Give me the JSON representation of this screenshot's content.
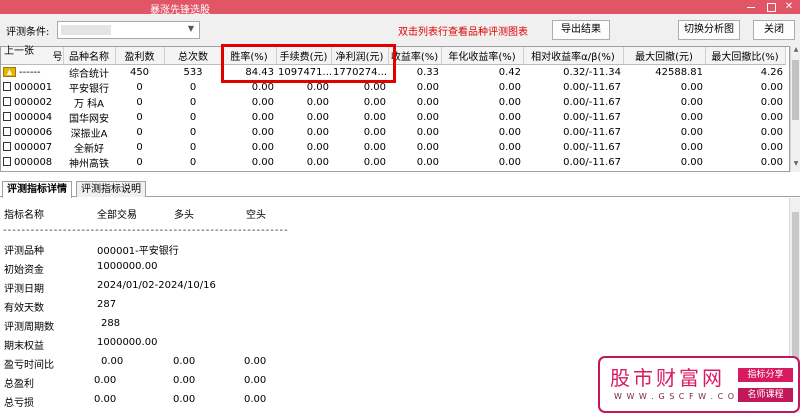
{
  "window": {
    "title": "暴涨先锋选股"
  },
  "toolbar": {
    "condition_label": "评测条件:",
    "hint": "双击列表行查看品种评测图表",
    "export_label": "导出结果",
    "chart_label": "切换分析图",
    "close_label": "关闭",
    "prev_label": "上一张"
  },
  "grid": {
    "columns": [
      "号",
      "品种名称",
      "盈利数",
      "总次数",
      "胜率(%)",
      "手续费(元)",
      "净利润(元)",
      "收益率(%)",
      "年化收益率(%)",
      "相对收益率α/β(%)",
      "最大回撤(元)",
      "最大回撤比(%)"
    ],
    "total_row": {
      "code": "------",
      "name": "综合统计",
      "profit": "450",
      "count": "533",
      "win": "84.43",
      "fee": "1097471...",
      "net": "1770274...",
      "ret": "0.33",
      "annual": "0.42",
      "rel": "0.32/-11.34",
      "mdd": "42588.81",
      "mddp": "4.26"
    },
    "rows": [
      {
        "code": "000001",
        "name": "平安银行",
        "profit": "0",
        "count": "0",
        "win": "0.00",
        "fee": "0.00",
        "net": "0.00",
        "ret": "0.00",
        "annual": "0.00",
        "rel": "0.00/-11.67",
        "mdd": "0.00",
        "mddp": "0.00"
      },
      {
        "code": "000002",
        "name": "万 科A",
        "profit": "0",
        "count": "0",
        "win": "0.00",
        "fee": "0.00",
        "net": "0.00",
        "ret": "0.00",
        "annual": "0.00",
        "rel": "0.00/-11.67",
        "mdd": "0.00",
        "mddp": "0.00"
      },
      {
        "code": "000004",
        "name": "国华网安",
        "profit": "0",
        "count": "0",
        "win": "0.00",
        "fee": "0.00",
        "net": "0.00",
        "ret": "0.00",
        "annual": "0.00",
        "rel": "0.00/-11.67",
        "mdd": "0.00",
        "mddp": "0.00"
      },
      {
        "code": "000006",
        "name": "深振业A",
        "profit": "0",
        "count": "0",
        "win": "0.00",
        "fee": "0.00",
        "net": "0.00",
        "ret": "0.00",
        "annual": "0.00",
        "rel": "0.00/-11.67",
        "mdd": "0.00",
        "mddp": "0.00"
      },
      {
        "code": "000007",
        "name": "全新好",
        "profit": "0",
        "count": "0",
        "win": "0.00",
        "fee": "0.00",
        "net": "0.00",
        "ret": "0.00",
        "annual": "0.00",
        "rel": "0.00/-11.67",
        "mdd": "0.00",
        "mddp": "0.00"
      },
      {
        "code": "000008",
        "name": "神州高铁",
        "profit": "0",
        "count": "0",
        "win": "0.00",
        "fee": "0.00",
        "net": "0.00",
        "ret": "0.00",
        "annual": "0.00",
        "rel": "0.00/-11.67",
        "mdd": "0.00",
        "mddp": "0.00"
      }
    ]
  },
  "tabs": [
    "评测指标详情",
    "评测指标说明"
  ],
  "detail": {
    "header": {
      "c1": "指标名称",
      "c2": "全部交易",
      "c3": "多头",
      "c4": "空头"
    },
    "dashes": "--------------------------------------------------------------",
    "items": [
      {
        "label": "评测品种",
        "v1": "000001-平安银行"
      },
      {
        "label": "初始资金",
        "v1": "1000000.00"
      },
      {
        "label": "评测日期",
        "v1": "2024/01/02-2024/10/16"
      },
      {
        "label": "有效天数",
        "v1": "287"
      },
      {
        "label": "评测周期数",
        "v1": "288"
      },
      {
        "label": "期末权益",
        "v1": "1000000.00"
      },
      {
        "label": "盈亏时间比",
        "v1": "0.00",
        "v2": "0.00",
        "v3": "0.00"
      },
      {
        "label": "总盈利",
        "v1": "0.00",
        "v2": "0.00",
        "v3": "0.00"
      },
      {
        "label": "总亏损",
        "v1": "0.00",
        "v2": "0.00",
        "v3": "0.00"
      }
    ]
  },
  "watermark": {
    "site_name": "股市财富网",
    "url": "W W W . G S C F W . C O M",
    "tag1": "指标分享",
    "tag2": "名师课程"
  },
  "colors": {
    "titlebar": "#e25566",
    "highlight": "#e00000",
    "hint": "#e00000",
    "watermark": "#d81b60"
  }
}
